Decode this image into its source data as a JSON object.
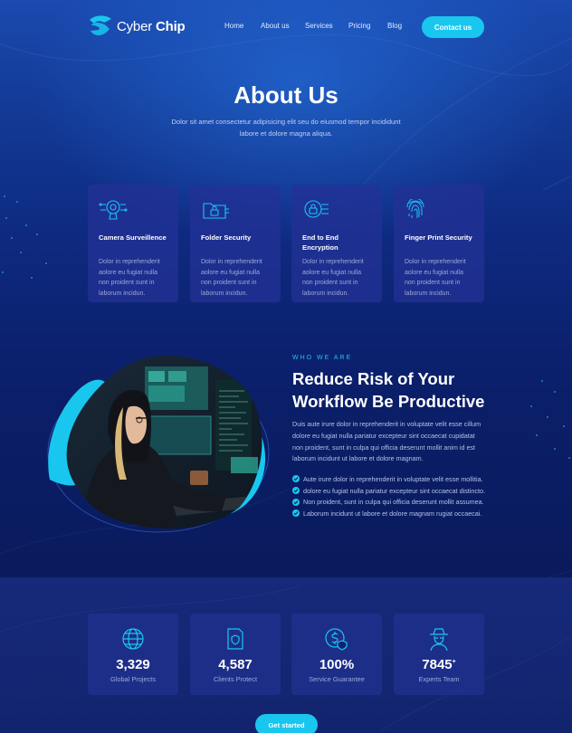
{
  "brand": {
    "name_light": "Cyber",
    "name_bold": "Chip",
    "accent": "#19c7ee"
  },
  "nav": {
    "items": [
      "Home",
      "About us",
      "Services",
      "Pricing",
      "Blog"
    ],
    "contact_label": "Contact us"
  },
  "hero": {
    "title": "About Us",
    "subtitle": "Dolor sit amet consectetur adipisicing elit seu do eiusmod tempor incididunt labore et dolore magna aliqua."
  },
  "features": [
    {
      "icon": "camera-icon",
      "title": "Camera Surveillence",
      "desc": "Dolor in reprehenderit aolore eu fugiat nulla non proident sunt in laborum incidun."
    },
    {
      "icon": "folder-lock-icon",
      "title": "Folder Security",
      "desc": "Dolor in reprehenderit aolore eu fugiat nulla non proident sunt in laborum incidun."
    },
    {
      "icon": "encryption-icon",
      "title": "End to End Encryption",
      "desc": "Dolor in reprehenderit aolore eu fugiat nulla non proident sunt in laborum incidun."
    },
    {
      "icon": "fingerprint-icon",
      "title": "Finger Print Security",
      "desc": "Dolor in reprehenderit aolore eu fugiat nulla non proident sunt in laborum incidun."
    }
  ],
  "risk": {
    "eyebrow": "WHO WE ARE",
    "title": "Reduce Risk of Your Workflow Be Productive",
    "desc": "Duis aute irure dolor in reprehenderit in voluptate velit esse cillum dolore eu fugiat nulla pariatur excepteur sint occaecat cupidatat non proident, sunt in culpa qui officia deserunt mollit anim id est laborum incidunt ut labore et dolore magnam.",
    "checks": [
      "Aute irure dolor in reprehenderit in voluptate velit esse mollitia.",
      "dolore eu fugiat nulla pariatur excepteur sint occaecat distincto.",
      "Non proident, sunt in culpa qui officia deserunt mollit assumea.",
      "Laborum incidunt ut labore et dolore magnam rugiat  occaecai."
    ]
  },
  "stats": [
    {
      "icon": "globe-icon",
      "value": "3,329",
      "sup": "",
      "label": "Global Projects"
    },
    {
      "icon": "shield-document-icon",
      "value": "4,587",
      "sup": "",
      "label": "Clients Protect"
    },
    {
      "icon": "dollar-shield-icon",
      "value": "100%",
      "sup": "",
      "label": "Service Guarantee"
    },
    {
      "icon": "hacker-icon",
      "value": "7845",
      "sup": "+",
      "label": "Experts Team"
    }
  ],
  "cta": {
    "label": "Get started"
  }
}
